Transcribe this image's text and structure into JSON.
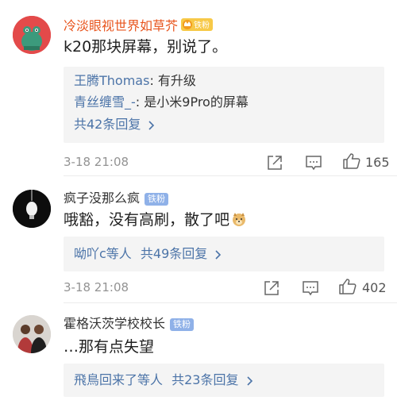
{
  "comments": [
    {
      "username": "冷淡眼视世界如草芥",
      "badge": "铁粉",
      "text": "k20那块屏幕，别说了。",
      "replies": [
        {
          "name": "王腾Thomas",
          "sep": ": ",
          "text": "有升级"
        },
        {
          "name": "青丝缠雪_-",
          "sep": ": ",
          "text": "是小米9Pro的屏幕"
        }
      ],
      "more_label": "共42条回复",
      "time": "3-18 21:08",
      "likes": "165"
    },
    {
      "username": "疯子没那么疯",
      "badge": "铁粉",
      "text": "哦豁，没有高刷，散了吧",
      "reply_summary_users": "呦吖c等人",
      "more_label": "共49条回复",
      "time": "3-18 21:08",
      "likes": "402"
    },
    {
      "username": "霍格沃茨学校校长",
      "badge": "铁粉",
      "text": "…那有点失望",
      "reply_summary_users": "飛鳥回来了等人",
      "more_label": "共23条回复"
    }
  ],
  "colors": {
    "username_highlight": "#e8541d",
    "username_normal": "#333333",
    "link_blue": "#4c74a8",
    "meta_gray": "#939393"
  },
  "icons": [
    "share-icon",
    "comment-icon",
    "like-icon",
    "chevron-right-icon",
    "vip-crown-icon",
    "doge-emoji-icon"
  ]
}
